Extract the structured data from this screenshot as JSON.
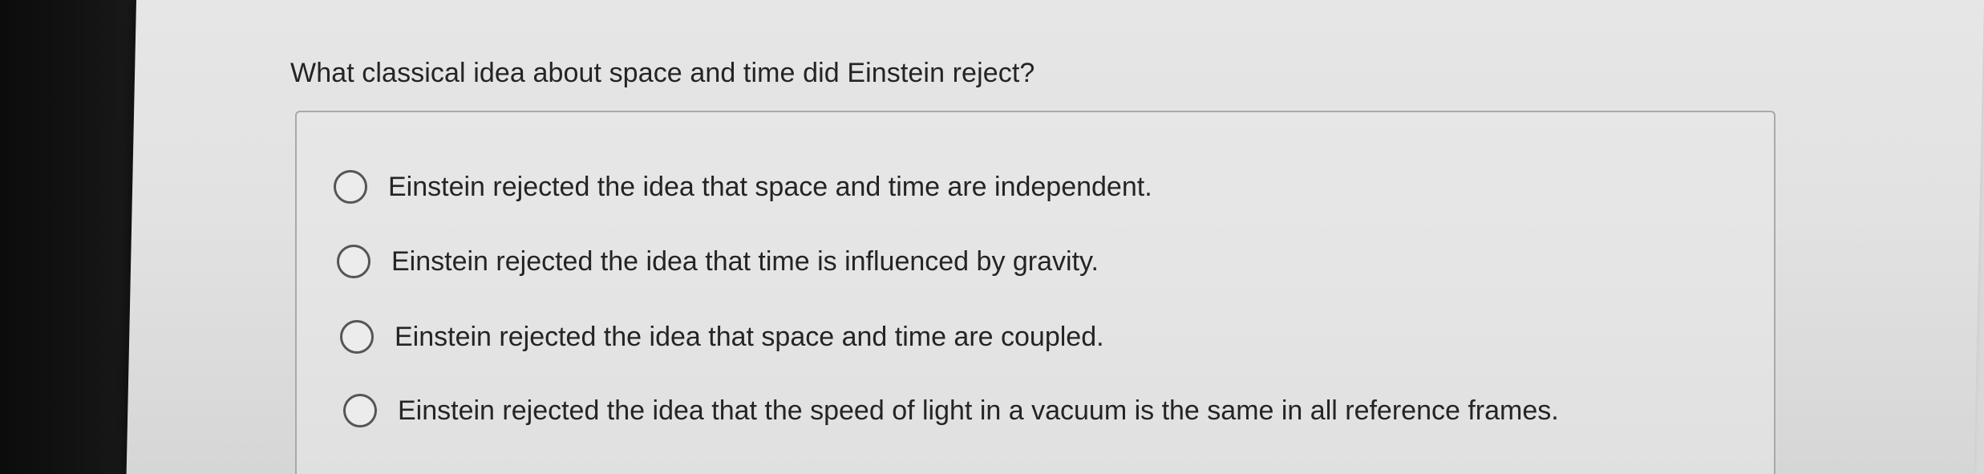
{
  "question": {
    "text": "What classical idea about space and time did Einstein reject?"
  },
  "options": [
    {
      "label": "Einstein rejected the idea that space and time are independent.",
      "selected": false
    },
    {
      "label": "Einstein rejected the idea that time is influenced by gravity.",
      "selected": false
    },
    {
      "label": "Einstein rejected the idea that space and time are coupled.",
      "selected": false
    },
    {
      "label": "Einstein rejected the idea that the speed of light in a vacuum is the same in all reference frames.",
      "selected": false
    }
  ],
  "colors": {
    "background": "#e2e2e2",
    "text": "#242424",
    "radio_border": "#555555",
    "box_border": "#a9a9a9",
    "bezel": "#111111"
  }
}
